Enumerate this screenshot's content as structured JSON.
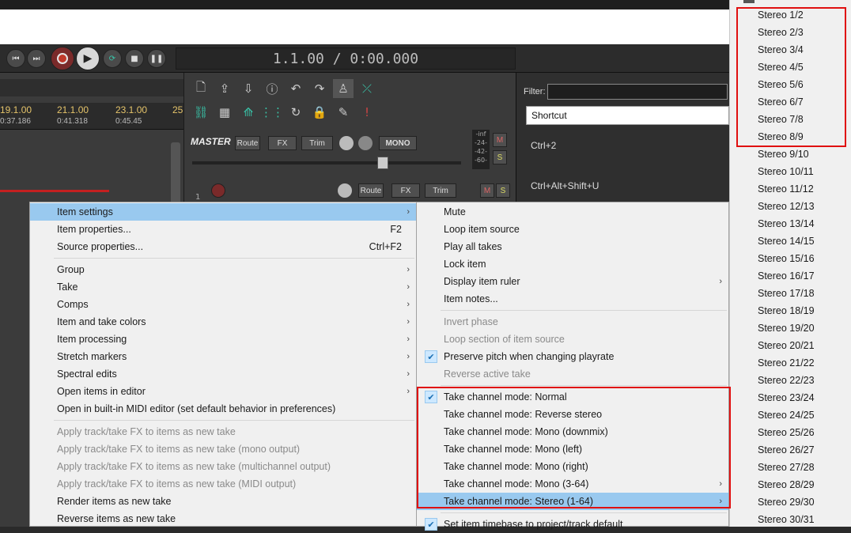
{
  "transport": {
    "timecode": "1.1.00 / 0:00.000"
  },
  "ruler": {
    "marks": [
      {
        "bar": "19.1.00",
        "time": "0:37.186"
      },
      {
        "bar": "21.1.00",
        "time": "0:41.318"
      },
      {
        "bar": "23.1.00",
        "time": "0:45.45"
      },
      {
        "bar": "25",
        "time": ""
      }
    ]
  },
  "mixer": {
    "master_label": "MASTER",
    "route": "Route",
    "fx": "FX",
    "trim": "Trim",
    "mono": "MONO",
    "mute": "M",
    "solo": "S",
    "meter": [
      "-inf",
      "-24-",
      "-42-",
      "-60-"
    ],
    "track_number": "1"
  },
  "actions": {
    "filter_label": "Filter:",
    "filter_value": "",
    "column_header": "Shortcut",
    "shortcuts": [
      "Ctrl+2",
      "Ctrl+Alt+Shift+U"
    ]
  },
  "menu1": {
    "items": [
      {
        "label": "Item settings",
        "arrow": "›",
        "highlight": true
      },
      {
        "label": "Item properties...",
        "shortcut": "F2"
      },
      {
        "label": "Source properties...",
        "shortcut": "Ctrl+F2"
      },
      {
        "sep": true
      },
      {
        "label": "Group",
        "arrow": "›"
      },
      {
        "label": "Take",
        "arrow": "›"
      },
      {
        "label": "Comps",
        "arrow": "›"
      },
      {
        "label": "Item and take colors",
        "arrow": "›"
      },
      {
        "label": "Item processing",
        "arrow": "›"
      },
      {
        "label": "Stretch markers",
        "arrow": "›"
      },
      {
        "label": "Spectral edits",
        "arrow": "›"
      },
      {
        "label": "Open items in editor",
        "arrow": "›"
      },
      {
        "label": "Open in built-in MIDI editor (set default behavior in preferences)"
      },
      {
        "sep": true
      },
      {
        "label": "Apply track/take FX to items as new take",
        "disabled": true
      },
      {
        "label": "Apply track/take FX to items as new take (mono output)",
        "disabled": true
      },
      {
        "label": "Apply track/take FX to items as new take (multichannel output)",
        "disabled": true
      },
      {
        "label": "Apply track/take FX to items as new take (MIDI output)",
        "disabled": true
      },
      {
        "label": "Render items as new take"
      },
      {
        "label": "Reverse items as new take"
      }
    ]
  },
  "menu2": {
    "items": [
      {
        "label": "Mute"
      },
      {
        "label": "Loop item source"
      },
      {
        "label": "Play all takes"
      },
      {
        "label": "Lock item"
      },
      {
        "label": "Display item ruler",
        "arrow": "›"
      },
      {
        "label": "Item notes..."
      },
      {
        "sep": true
      },
      {
        "label": "Invert phase",
        "disabled": true
      },
      {
        "label": "Loop section of item source",
        "disabled": true
      },
      {
        "label": "Preserve pitch when changing playrate",
        "checked": true
      },
      {
        "label": "Reverse active take",
        "disabled": true
      },
      {
        "sep": true
      },
      {
        "label": "Take channel mode: Normal",
        "checked": true
      },
      {
        "label": "Take channel mode: Reverse stereo"
      },
      {
        "label": "Take channel mode: Mono (downmix)"
      },
      {
        "label": "Take channel mode: Mono (left)"
      },
      {
        "label": "Take channel mode: Mono (right)"
      },
      {
        "label": "Take channel mode: Mono (3-64)",
        "arrow": "›"
      },
      {
        "label": "Take channel mode: Stereo (1-64)",
        "arrow": "›",
        "highlight": true
      },
      {
        "sep": true
      },
      {
        "label": "Set item timebase to project/track default",
        "checked": true
      }
    ]
  },
  "stereo_menu": {
    "items": [
      "Stereo 1/2",
      "Stereo 2/3",
      "Stereo 3/4",
      "Stereo 4/5",
      "Stereo 5/6",
      "Stereo 6/7",
      "Stereo 7/8",
      "Stereo 8/9",
      "Stereo 9/10",
      "Stereo 10/11",
      "Stereo 11/12",
      "Stereo 12/13",
      "Stereo 13/14",
      "Stereo 14/15",
      "Stereo 15/16",
      "Stereo 16/17",
      "Stereo 17/18",
      "Stereo 18/19",
      "Stereo 19/20",
      "Stereo 20/21",
      "Stereo 21/22",
      "Stereo 22/23",
      "Stereo 23/24",
      "Stereo 24/25",
      "Stereo 25/26",
      "Stereo 26/27",
      "Stereo 27/28",
      "Stereo 28/29",
      "Stereo 29/30",
      "Stereo 30/31"
    ]
  },
  "colors": {
    "highlight": "#99c9ef",
    "annotation": "#e01010",
    "record": "#c0392b",
    "teal": "#39c3a8"
  }
}
